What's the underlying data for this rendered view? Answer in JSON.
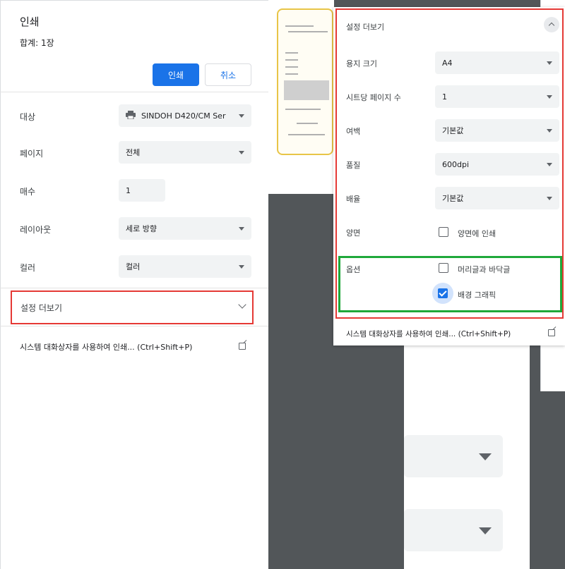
{
  "left_panel": {
    "title": "인쇄",
    "total": "합계: 1장",
    "print_button": "인쇄",
    "cancel_button": "취소",
    "rows": [
      {
        "label": "대상",
        "value": "SINDOH D420/CM Ser",
        "icon": "printer-icon"
      },
      {
        "label": "페이지",
        "value": "전체"
      },
      {
        "label": "매수",
        "value": "1"
      },
      {
        "label": "레이아웃",
        "value": "세로 방향"
      },
      {
        "label": "컬러",
        "value": "컬러"
      }
    ],
    "more_settings": "설정 더보기",
    "system_dialog": "시스템 대화상자를 사용하여 인쇄... (Ctrl+Shift+P)"
  },
  "dropdown": {
    "title": "설정 더보기",
    "rows": [
      {
        "label": "용지 크기",
        "value": "A4"
      },
      {
        "label": "시트당 페이지 수",
        "value": "1"
      },
      {
        "label": "여백",
        "value": "기본값"
      },
      {
        "label": "품질",
        "value": "600dpi"
      },
      {
        "label": "배율",
        "value": "기본값"
      }
    ],
    "duplex_label": "양면",
    "duplex_option": "양면에 인쇄",
    "duplex_checked": false,
    "options_label": "옵션",
    "header_footer": "머리글과 바닥글",
    "header_footer_checked": false,
    "background_graphics": "배경 그래픽",
    "background_graphics_checked": true,
    "system_dialog": "시스템 대화상자를 사용하여 인쇄... (Ctrl+Shift+P)"
  },
  "colors": {
    "accent": "#1a73e8",
    "highlight_red": "#e53935",
    "highlight_green": "#1fa83a",
    "preview_bg": "#525659"
  }
}
